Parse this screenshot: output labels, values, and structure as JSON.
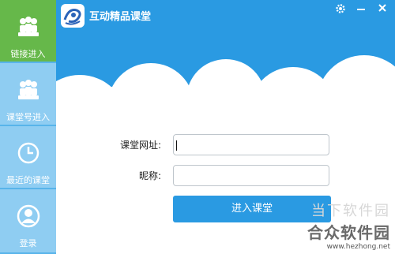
{
  "app": {
    "title": "互动精品课堂"
  },
  "window": {
    "settings_icon": "gear-icon",
    "close_icon": "close-icon"
  },
  "sidebar": {
    "items": [
      {
        "label": "链接进入",
        "icon": "group-icon",
        "active": true
      },
      {
        "label": "课堂号进入",
        "icon": "group-icon",
        "active": false
      },
      {
        "label": "最近的课堂",
        "icon": "clock-icon",
        "active": false
      },
      {
        "label": "登录",
        "icon": "user-icon",
        "active": false
      }
    ]
  },
  "form": {
    "url_label": "课堂网址:",
    "url_value": "",
    "nickname_label": "昵称:",
    "nickname_value": "",
    "enter_label": "进入课堂"
  },
  "watermark": {
    "line1": "当下软件园",
    "line2": "合众软件园",
    "url": "www.hezhong.net"
  },
  "colors": {
    "primary": "#2a9ae2",
    "active_tab": "#66b84a",
    "sidebar": "#8fcdf2"
  }
}
